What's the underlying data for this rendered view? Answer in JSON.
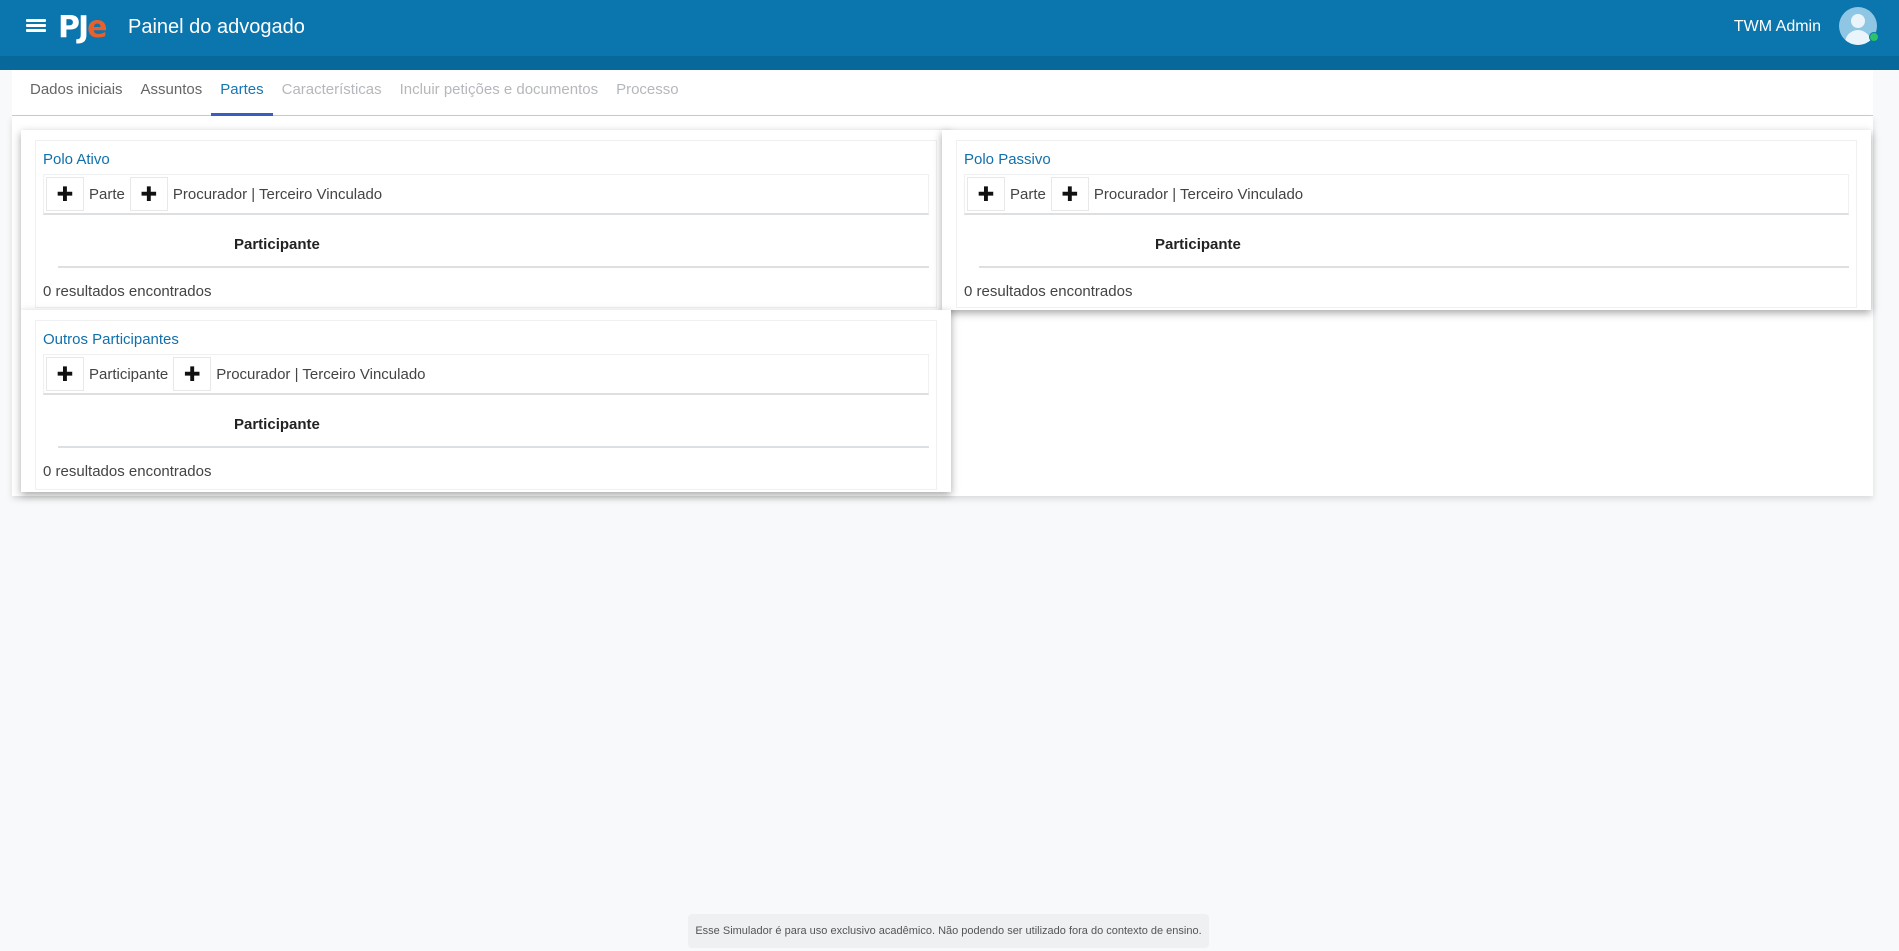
{
  "header": {
    "logo_pj": "PJ",
    "logo_e": "e",
    "title": "Painel do advogado",
    "user_name": "TWM Admin",
    "menu_icon": "hamburger-menu-icon",
    "avatar_icon": "user-avatar-icon"
  },
  "tabs": [
    {
      "label": "Dados iniciais",
      "state": "enabled"
    },
    {
      "label": "Assuntos",
      "state": "enabled"
    },
    {
      "label": "Partes",
      "state": "active"
    },
    {
      "label": "Características",
      "state": "disabled"
    },
    {
      "label": "Incluir petições e documentos",
      "state": "disabled"
    },
    {
      "label": "Processo",
      "state": "disabled"
    }
  ],
  "polo_ativo": {
    "title": "Polo Ativo",
    "add_party_label": "Parte",
    "add_representative_label": "Procurador | Terceiro Vinculado",
    "column_header": "Participante",
    "result_count": "0 resultados encontrados"
  },
  "polo_passivo": {
    "title": "Polo Passivo",
    "add_party_label": "Parte",
    "add_representative_label": "Procurador | Terceiro Vinculado",
    "column_header": "Participante",
    "result_count": "0 resultados encontrados"
  },
  "outros_participantes": {
    "title": "Outros Participantes",
    "add_party_label": "Participante",
    "add_representative_label": "Procurador | Terceiro Vinculado",
    "column_header": "Participante",
    "result_count": "0 resultados encontrados"
  },
  "plus_glyph": "✚",
  "footer_notice": "Esse Simulador é para uso exclusivo acadêmico. Não podendo ser utilizado fora do contexto de ensino.",
  "colors": {
    "header_bg": "#0b75ad",
    "accent": "#1677b4",
    "logo_e": "#e8602c",
    "online_status": "#2bc26a"
  }
}
